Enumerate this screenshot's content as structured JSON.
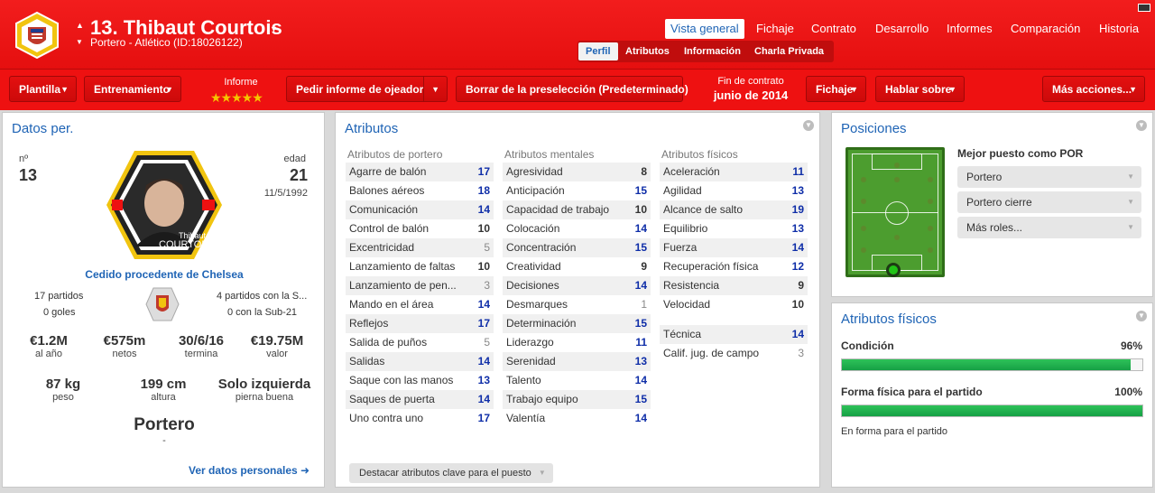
{
  "header": {
    "player_title": "13. Thibaut Courtois",
    "player_subtitle": "Portero - Atlético (ID:18026122)",
    "nav_tabs": [
      "Vista general",
      "Fichaje",
      "Contrato",
      "Desarrollo",
      "Informes",
      "Comparación",
      "Historia"
    ],
    "sub_tabs": [
      "Perfil",
      "Atributos",
      "Información",
      "Charla Privada"
    ]
  },
  "toolbar": {
    "squad_label": "Plantilla",
    "training_label": "Entrenamiento",
    "report_label": "Informe",
    "report_stars": "★★★★★",
    "scout_label": "Pedir informe de ojeador",
    "shortlist_label": "Borrar de la preselección (Predeterminado)",
    "contract_end_label": "Fin de contrato",
    "contract_end_value": "junio de 2014",
    "transfer_label": "Fichaje",
    "talk_label": "Hablar sobre",
    "more_label": "Más acciones..."
  },
  "personal": {
    "title": "Datos per.",
    "number_label": "nº",
    "number_value": "13",
    "age_label": "edad",
    "age_value": "21",
    "birth_date": "11/5/1992",
    "card_first_name": "Thibaut",
    "card_last_name": "COURTOIS",
    "loan_text": "Cedido procedente de Chelsea",
    "club_apps": "17 partidos",
    "club_goals": "0 goles",
    "intl_apps": "4 partidos con la S...",
    "intl_u21": "0 con la Sub-21",
    "wage_value": "€1.2M",
    "wage_label": "al año",
    "net_value": "€575m",
    "net_label": "netos",
    "end_value": "30/6/16",
    "end_label": "termina",
    "market_value": "€19.75M",
    "market_label": "valor",
    "weight_value": "87 kg",
    "weight_label": "peso",
    "height_value": "199 cm",
    "height_label": "altura",
    "foot_value": "Solo izquierda",
    "foot_label": "pierna buena",
    "position_value": "Portero",
    "position_dash": "-",
    "link_label": "Ver datos personales ➜"
  },
  "attributes": {
    "title": "Atributos",
    "gk_header": "Atributos de portero",
    "mental_header": "Atributos mentales",
    "physical_header": "Atributos físicos",
    "goalkeeping": [
      {
        "name": "Agarre de balón",
        "value": "17"
      },
      {
        "name": "Balones aéreos",
        "value": "18"
      },
      {
        "name": "Comunicación",
        "value": "14"
      },
      {
        "name": "Control de balón",
        "value": "10"
      },
      {
        "name": "Excentricidad",
        "value": "5"
      },
      {
        "name": "Lanzamiento de faltas",
        "value": "10"
      },
      {
        "name": "Lanzamiento de pen...",
        "value": "3"
      },
      {
        "name": "Mando en el área",
        "value": "14"
      },
      {
        "name": "Reflejos",
        "value": "17"
      },
      {
        "name": "Salida de puños",
        "value": "5"
      },
      {
        "name": "Salidas",
        "value": "14"
      },
      {
        "name": "Saque con las manos",
        "value": "13"
      },
      {
        "name": "Saques de puerta",
        "value": "14"
      },
      {
        "name": "Uno contra uno",
        "value": "17"
      }
    ],
    "mental": [
      {
        "name": "Agresividad",
        "value": "8"
      },
      {
        "name": "Anticipación",
        "value": "15"
      },
      {
        "name": "Capacidad de trabajo",
        "value": "10"
      },
      {
        "name": "Colocación",
        "value": "14"
      },
      {
        "name": "Concentración",
        "value": "15"
      },
      {
        "name": "Creatividad",
        "value": "9"
      },
      {
        "name": "Decisiones",
        "value": "14"
      },
      {
        "name": "Desmarques",
        "value": "1"
      },
      {
        "name": "Determinación",
        "value": "15"
      },
      {
        "name": "Liderazgo",
        "value": "11"
      },
      {
        "name": "Serenidad",
        "value": "13"
      },
      {
        "name": "Talento",
        "value": "14"
      },
      {
        "name": "Trabajo equipo",
        "value": "15"
      },
      {
        "name": "Valentía",
        "value": "14"
      }
    ],
    "physical": [
      {
        "name": "Aceleración",
        "value": "11"
      },
      {
        "name": "Agilidad",
        "value": "13"
      },
      {
        "name": "Alcance de salto",
        "value": "19"
      },
      {
        "name": "Equilibrio",
        "value": "13"
      },
      {
        "name": "Fuerza",
        "value": "14"
      },
      {
        "name": "Recuperación física",
        "value": "12"
      },
      {
        "name": "Resistencia",
        "value": "9"
      },
      {
        "name": "Velocidad",
        "value": "10"
      }
    ],
    "technical": [
      {
        "name": "Técnica",
        "value": "14"
      },
      {
        "name": "Calif. jug. de campo",
        "value": "3"
      }
    ],
    "highlight_button": "Destacar atributos clave para el puesto"
  },
  "positions": {
    "title": "Posiciones",
    "best_role_label": "Mejor puesto como POR",
    "roles": [
      "Portero",
      "Portero cierre",
      "Más roles..."
    ]
  },
  "physical_panel": {
    "title": "Atributos físicos",
    "condition_label": "Condición",
    "condition_value": "96%",
    "condition_fraction": 0.96,
    "match_fitness_label": "Forma física para el partido",
    "match_fitness_value": "100%",
    "match_fitness_fraction": 1.0,
    "form_status": "En forma para el partido"
  },
  "colors": {
    "header_red": "#ee1111",
    "link_blue": "#1f64b5",
    "bar_green": "#1fae4c",
    "pitch_green": "#4c9d2f"
  }
}
